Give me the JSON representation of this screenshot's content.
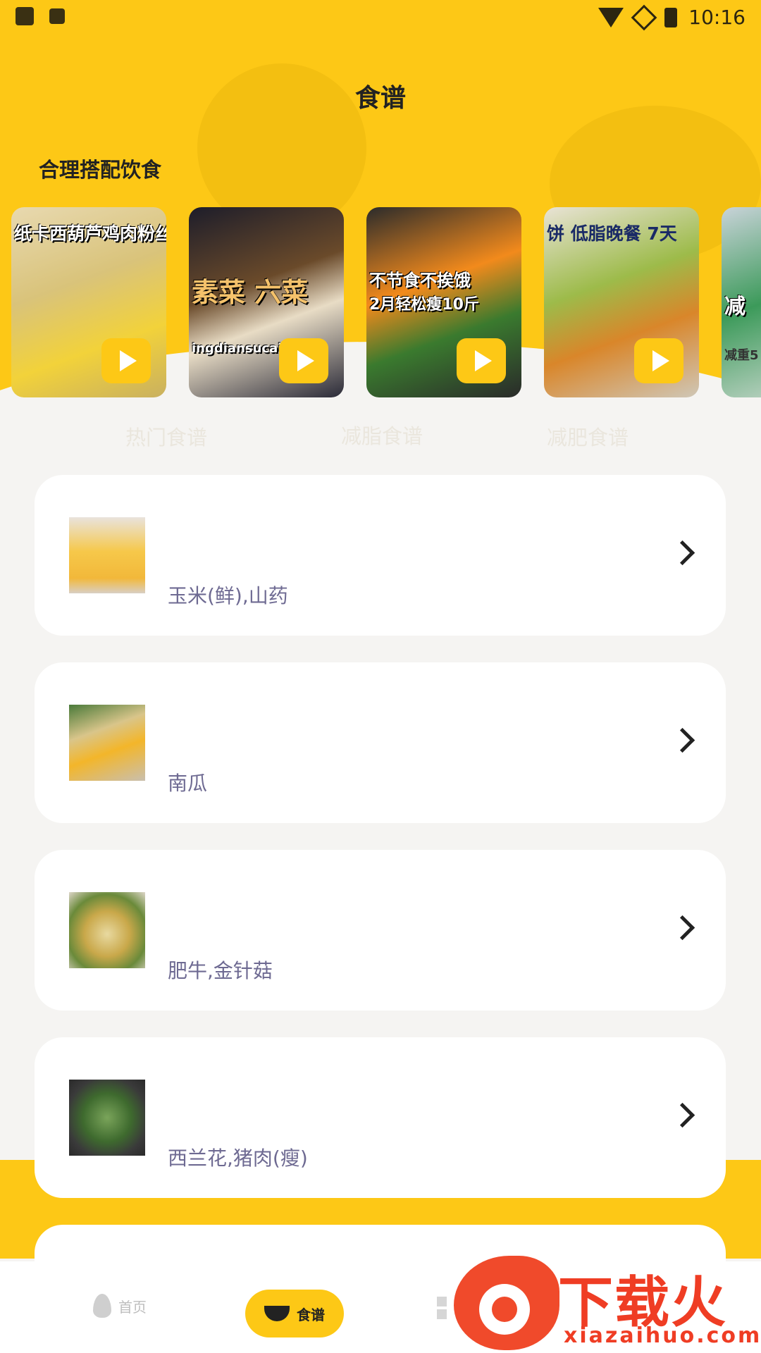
{
  "status_bar": {
    "time": "10:16"
  },
  "header": {
    "title": "食谱"
  },
  "section": {
    "title": "合理搭配饮食"
  },
  "video_cards": [
    {
      "caption": "纸卡西葫芦鸡肉粉丝汤",
      "subcaption": ""
    },
    {
      "caption": "素菜 六菜",
      "subcaption": "ingdiansucai.la"
    },
    {
      "caption": "不节食不挨饿",
      "subcaption": "2月轻松瘦10斤"
    },
    {
      "caption": "饼 低脂晚餐 7天",
      "subcaption": ""
    },
    {
      "caption": "减",
      "subcaption": "减重5"
    }
  ],
  "category_tabs": [
    "热门食谱",
    "减脂食谱",
    "减肥食谱"
  ],
  "recipes": [
    {
      "ingredients": "玉米(鲜),山药"
    },
    {
      "ingredients": "南瓜"
    },
    {
      "ingredients": "肥牛,金针菇"
    },
    {
      "ingredients": "西兰花,猪肉(瘦)"
    }
  ],
  "tab_bar": {
    "home_label": "首页",
    "recipe_label": "食谱"
  },
  "watermark": {
    "brand": "下载火",
    "url": "xiazaihuo.com"
  },
  "colors": {
    "accent": "#fdc816",
    "ingredient_text": "#6e6a92"
  }
}
